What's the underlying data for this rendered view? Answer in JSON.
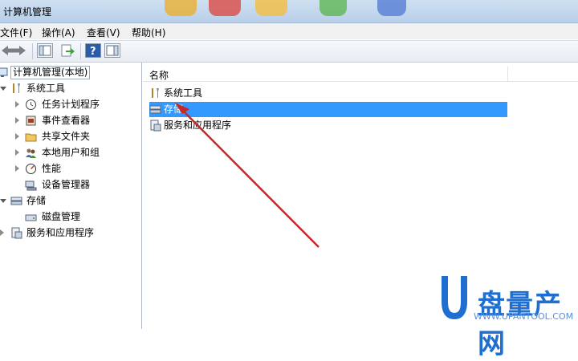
{
  "window": {
    "title": "计算机管理"
  },
  "menu": [
    "文件(F)",
    "操作(A)",
    "查看(V)",
    "帮助(H)"
  ],
  "toolbar": {
    "back_icon": "back-arrow-icon",
    "forward_icon": "forward-arrow-icon"
  },
  "tree": {
    "root": "计算机管理(本地)",
    "system_tools": "系统工具",
    "task_scheduler": "任务计划程序",
    "event_viewer": "事件查看器",
    "shared_folders": "共享文件夹",
    "local_users": "本地用户和组",
    "performance": "性能",
    "device_manager": "设备管理器",
    "storage": "存储",
    "disk_management": "磁盘管理",
    "services_apps": "服务和应用程序"
  },
  "list": {
    "column_name": "名称",
    "items": [
      "系统工具",
      "存储",
      "服务和应用程序"
    ],
    "selected_index": 1
  },
  "watermark": {
    "brand": "盘量产网",
    "url": "WWW.UPANTOOL.COM"
  },
  "colors": {
    "selection": "#3399ff",
    "annotation_arrow": "#c62828"
  }
}
